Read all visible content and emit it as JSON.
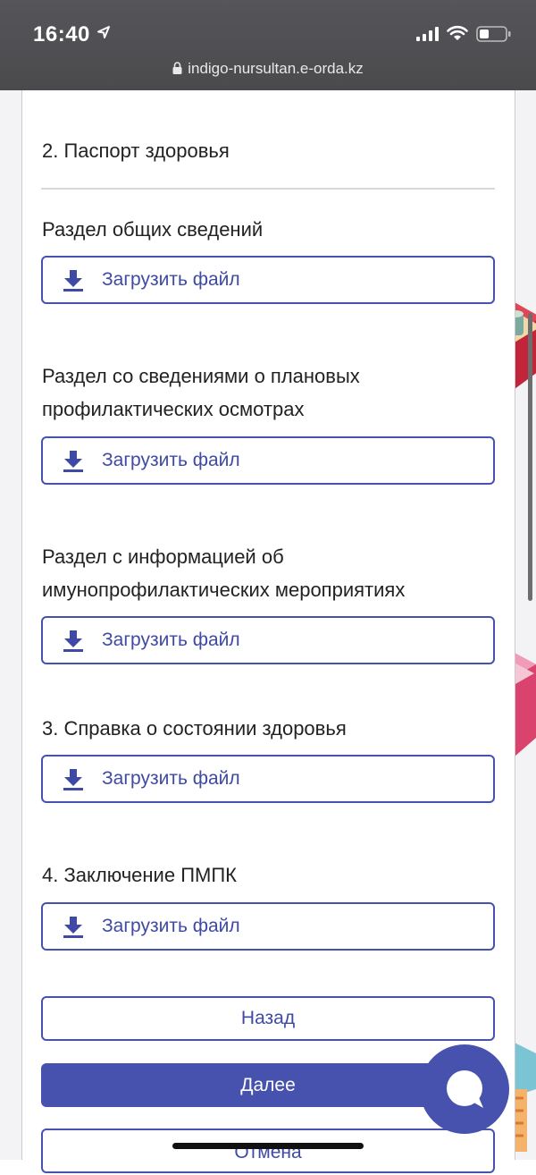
{
  "status_bar": {
    "time": "16:40"
  },
  "browser": {
    "url": "indigo-nursultan.e-orda.kz"
  },
  "sections": {
    "health_passport": {
      "title": "2. Паспорт здоровья"
    },
    "general_info": {
      "title": "Раздел общих сведений",
      "button": "Загрузить файл"
    },
    "checkups": {
      "title_line1": "Раздел со сведениями о плановых",
      "title_line2": "профилактических осмотрах",
      "button": "Загрузить файл"
    },
    "immuno": {
      "title_line1": "Раздел с информацией об",
      "title_line2": "имунопрофилактических мероприятиях",
      "button": "Загрузить файл"
    },
    "health_certificate": {
      "title": "3. Справка о состоянии здоровья",
      "button": "Загрузить файл"
    },
    "pmpk": {
      "title": "4. Заключение ПМПК",
      "button": "Загрузить файл"
    }
  },
  "actions": {
    "back": "Назад",
    "next": "Далее",
    "cancel": "Отмена"
  },
  "colors": {
    "accent": "#4652ad",
    "topbar": "#4f4f52"
  },
  "icons": [
    "location-arrow-icon",
    "signal-icon",
    "wifi-icon",
    "battery-icon",
    "lock-icon",
    "download-icon",
    "chat-icon"
  ]
}
